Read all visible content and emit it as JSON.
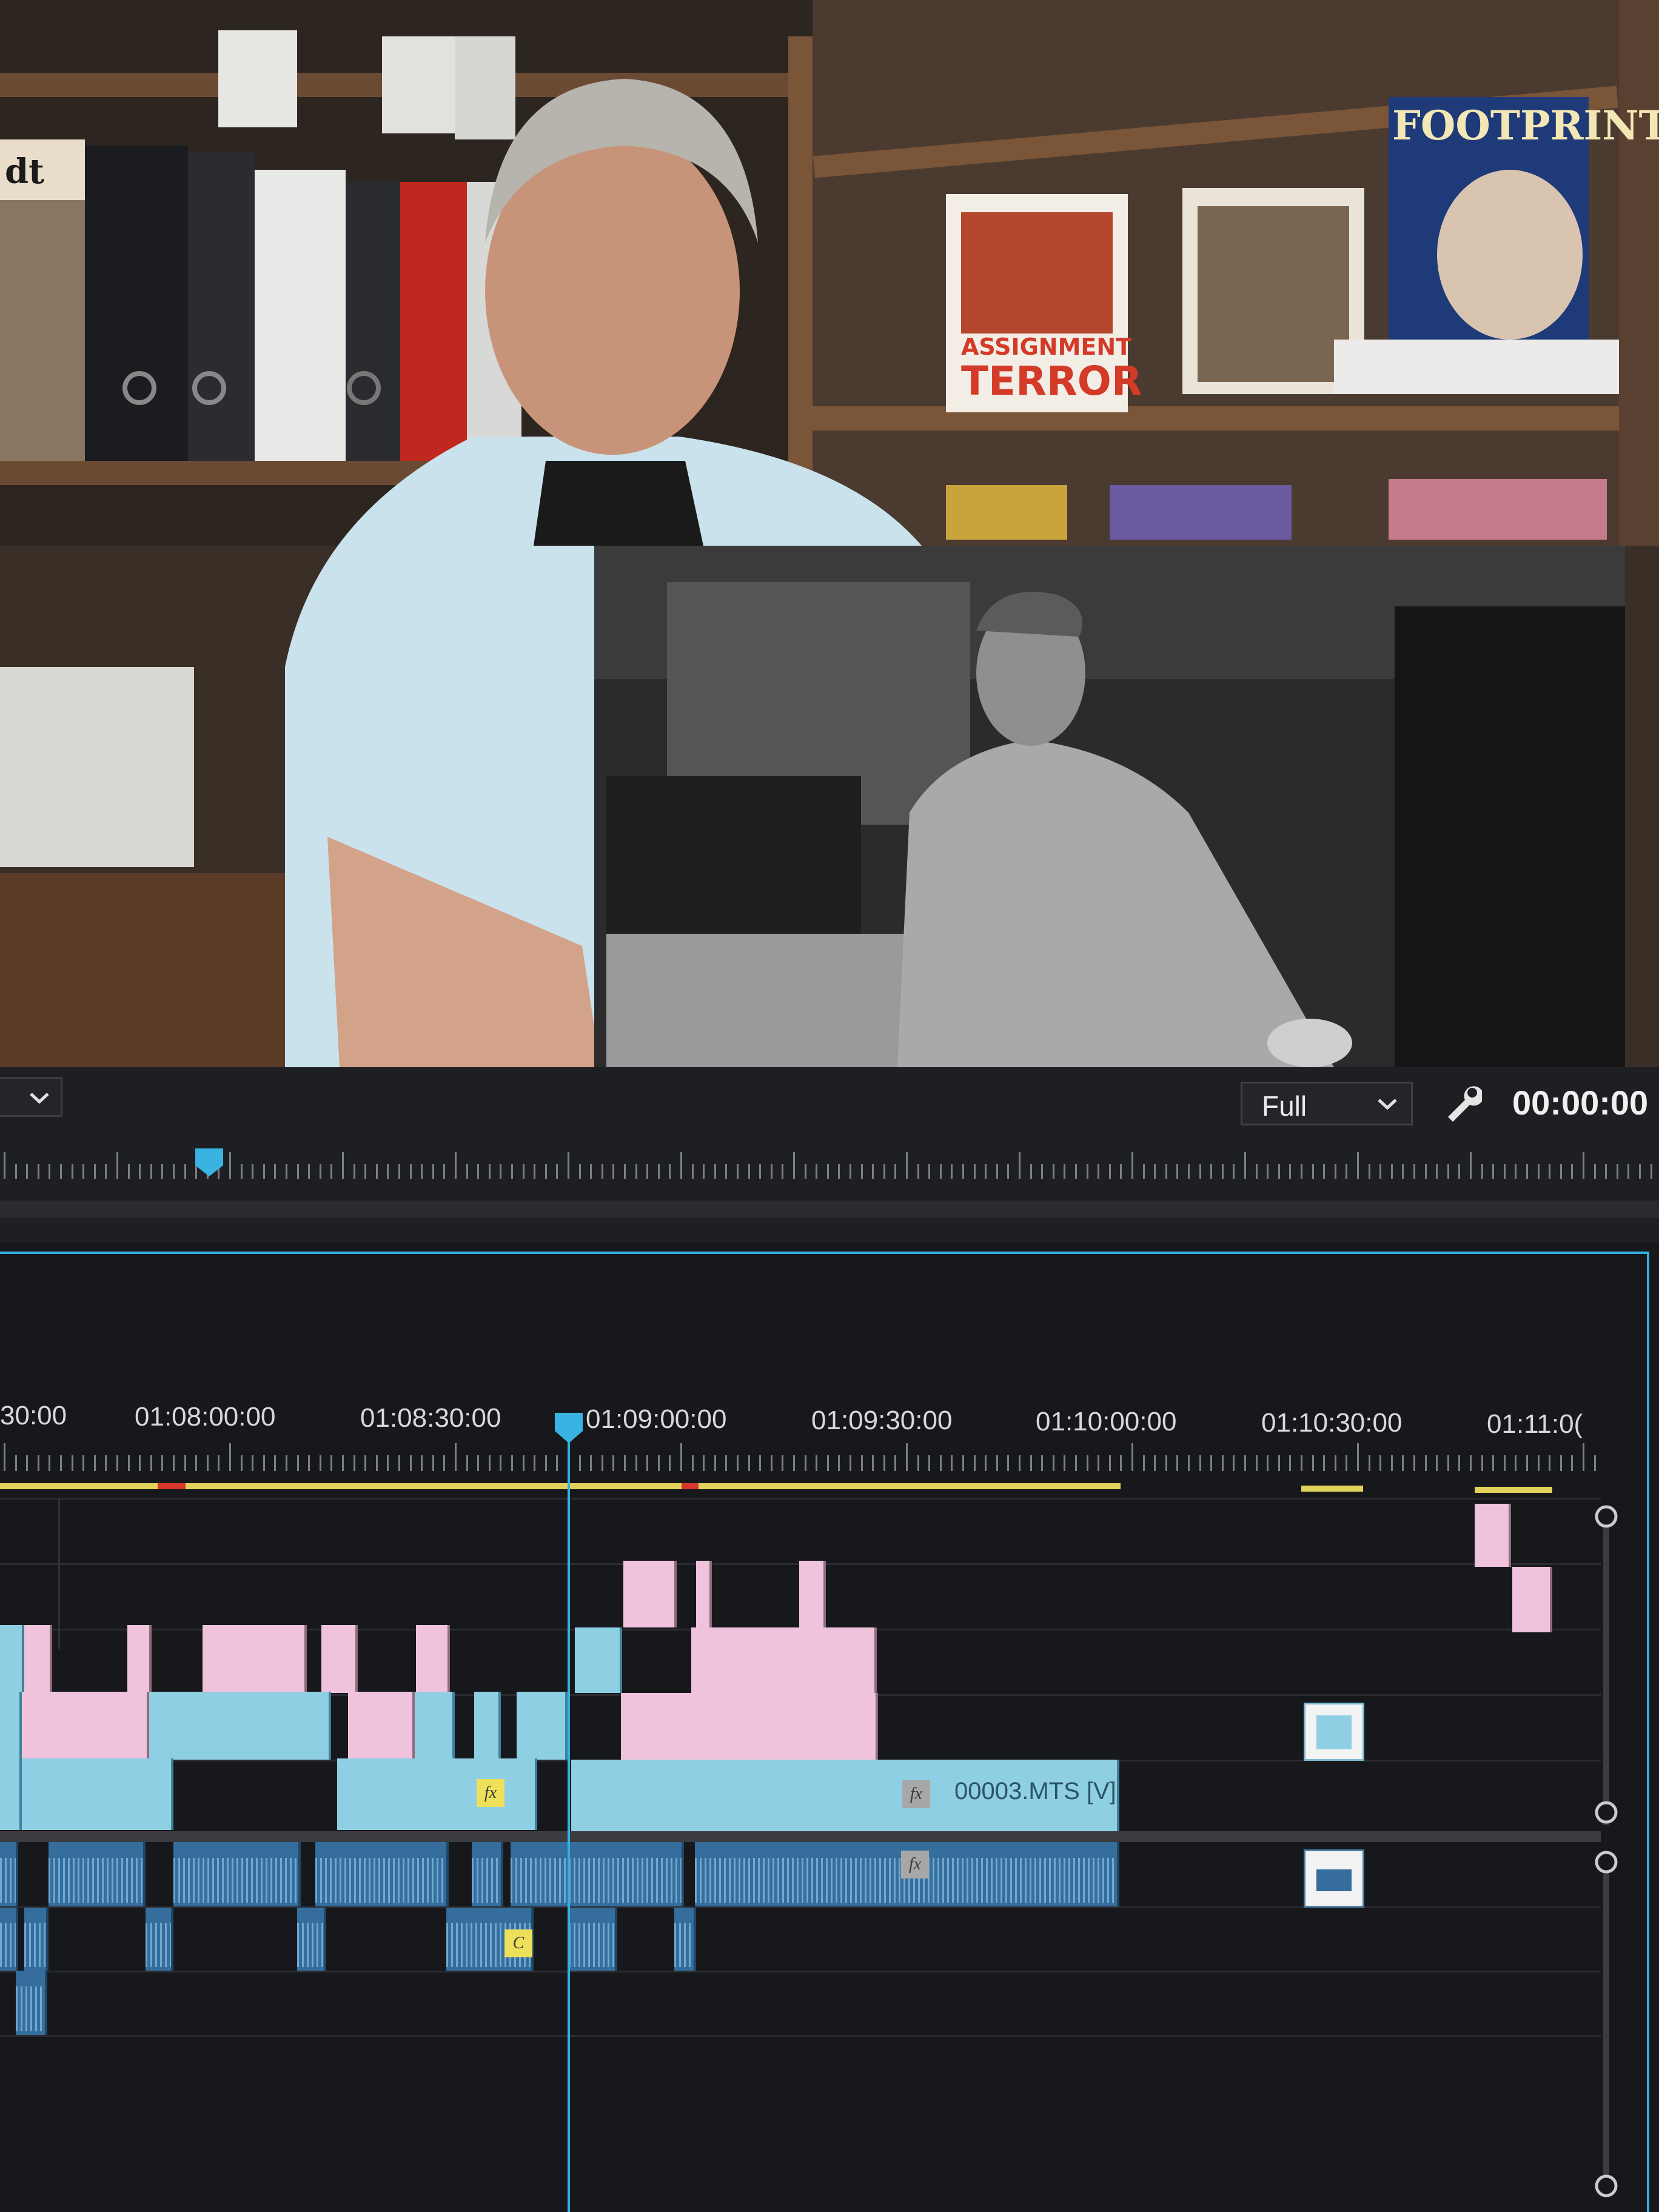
{
  "program_monitor": {
    "scene": "Video frame of an interview in a study with bookshelves and an inset black-and-white film still",
    "zoom_dropdown": "Full",
    "timecode": "00:00:00",
    "dropdown_left": "",
    "posters": [
      {
        "lines": [
          "FOOTPRINTS"
        ]
      },
      {
        "lines": [
          "ASSIGNMENT",
          "TERROR"
        ]
      }
    ],
    "binder_label": "dt"
  },
  "timeline": {
    "ruler_labels": [
      "30:00",
      "01:08:00:00",
      "01:08:30:00",
      "01:09:00:00",
      "01:09:30:00",
      "01:10:00:00",
      "01:10:30:00",
      "01:11:0("
    ],
    "clip_name": "00003.MTS [V]"
  },
  "colors": {
    "accent": "#35b0df",
    "video_clip": "#8fcfe3",
    "pink_clip": "#efc3dc",
    "audio_clip": "#356e9c",
    "render_bar": "#e0d25a"
  }
}
